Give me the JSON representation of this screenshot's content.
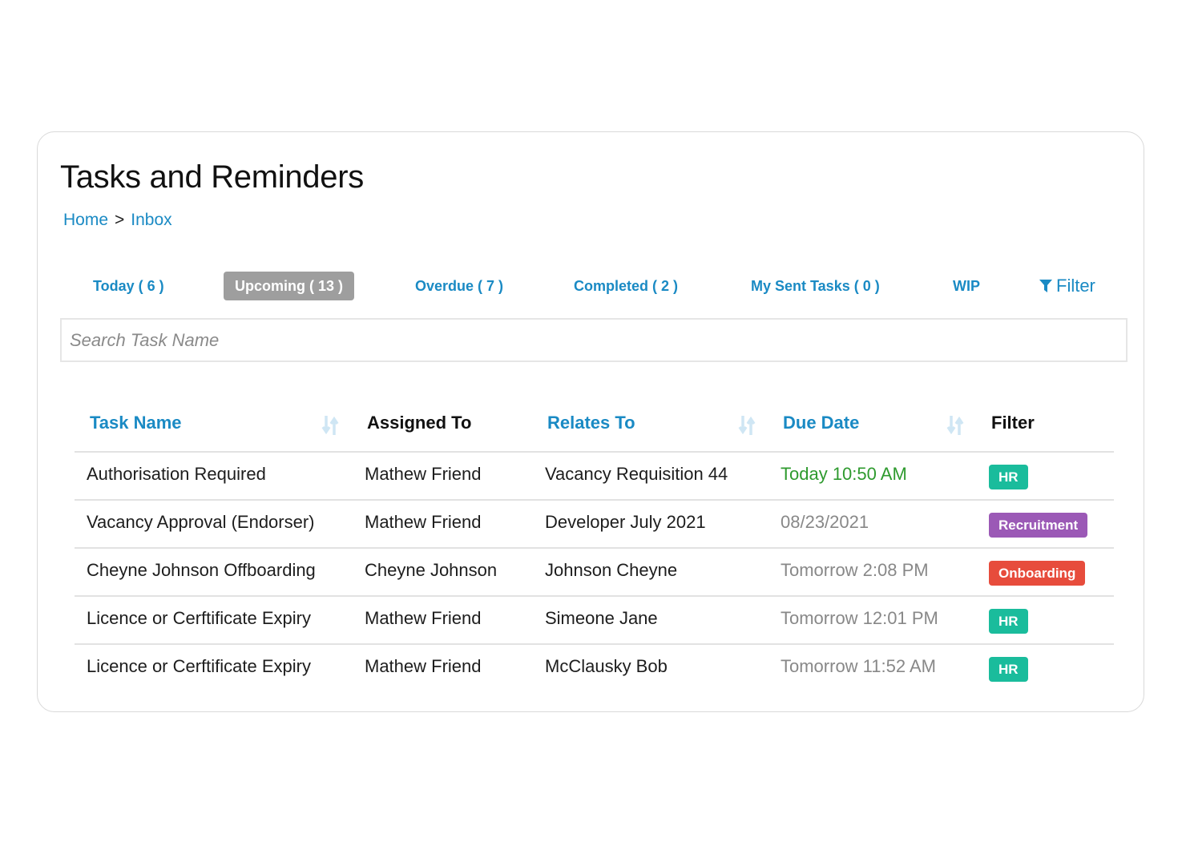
{
  "page": {
    "title": "Tasks and Reminders"
  },
  "breadcrumb": {
    "items": [
      "Home",
      "Inbox"
    ],
    "separator": ">"
  },
  "tabs": [
    {
      "label": "Today ( 6 )",
      "active": false
    },
    {
      "label": "Upcoming ( 13 )",
      "active": true
    },
    {
      "label": "Overdue ( 7 )",
      "active": false
    },
    {
      "label": "Completed ( 2 )",
      "active": false
    },
    {
      "label": "My Sent Tasks ( 0 )",
      "active": false
    },
    {
      "label": "WIP",
      "active": false
    },
    {
      "label": "Filter",
      "icon": "filter-funnel-icon",
      "active": false
    }
  ],
  "search": {
    "placeholder": "Search Task Name",
    "value": ""
  },
  "table": {
    "columns": [
      {
        "label": "Task Name",
        "sortable": true
      },
      {
        "label": "Assigned To",
        "sortable": false
      },
      {
        "label": "Relates To",
        "sortable": true
      },
      {
        "label": "Due Date",
        "sortable": true
      },
      {
        "label": "Filter",
        "sortable": false
      }
    ],
    "rows": [
      {
        "task": "Authorisation Required",
        "assigned": "Mathew Friend",
        "relates": "Vacancy Requisition 44",
        "due": "Today 10:50 AM",
        "due_today": true,
        "tag": "HR",
        "tag_color": "#1abc9c"
      },
      {
        "task": "Vacancy Approval (Endorser)",
        "assigned": "Mathew Friend",
        "relates": "Developer July 2021",
        "due": "08/23/2021",
        "due_today": false,
        "tag": "Recruitment",
        "tag_color": "#9b59b6"
      },
      {
        "task": "Cheyne Johnson Offboarding",
        "assigned": "Cheyne Johnson",
        "relates": "Johnson Cheyne",
        "due": "Tomorrow 2:08 PM",
        "due_today": false,
        "tag": "Onboarding",
        "tag_color": "#e74c3c"
      },
      {
        "task": "Licence or Cerftificate Expiry",
        "assigned": "Mathew Friend",
        "relates": "Simeone Jane",
        "due": "Tomorrow 12:01 PM",
        "due_today": false,
        "tag": "HR",
        "tag_color": "#1abc9c"
      },
      {
        "task": "Licence or Cerftificate Expiry",
        "assigned": "Mathew Friend",
        "relates": "McClausky Bob",
        "due": "Tomorrow 11:52 AM",
        "due_today": false,
        "tag": "HR",
        "tag_color": "#1abc9c"
      }
    ]
  },
  "colors": {
    "accent": "#1a8ac4",
    "active_tab_bg": "#9e9e9e",
    "due_today": "#2e9a2e",
    "due_other": "#888888"
  }
}
